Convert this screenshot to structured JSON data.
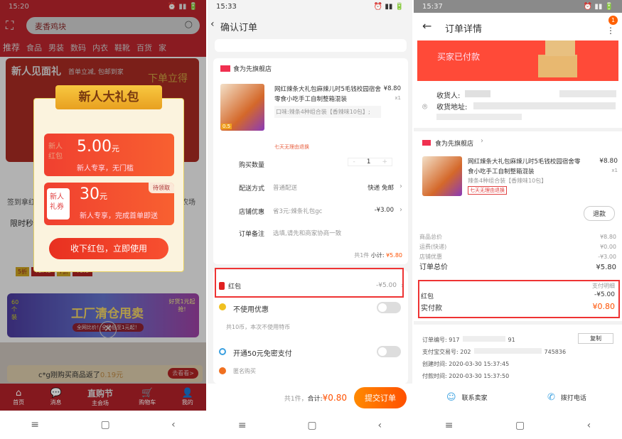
{
  "p1": {
    "time": "15:20",
    "search_value": "麦香鸡块",
    "tabs": [
      "推荐",
      "食品",
      "男装",
      "数码",
      "内衣",
      "鞋靴",
      "百货",
      "家"
    ],
    "banner_title": "新人见面礼",
    "banner_sub": "首单立减, 包邮到家",
    "banner_right": "下单立得",
    "side_left": "签到拿红",
    "side_right": "农场",
    "flash": "限时秒",
    "modal": {
      "title": "新人大礼包",
      "coupon1": {
        "tag": "新人红包",
        "amount": "5.00",
        "unit": "元",
        "desc": "新人专享，无门槛"
      },
      "coupon2": {
        "tag": "新人礼券",
        "amount": "30",
        "unit": "元",
        "desc": "新人专享，完成首单即送",
        "badge": "待领取"
      },
      "button": "收下红包，立即使用"
    },
    "discount_tags": [
      "5折",
      "¥2.45",
      "7折",
      "¥9.8"
    ],
    "promo_title": "工厂清仓甩卖",
    "promo_sub": "全网比价！全场低至1元起！",
    "promo_left": "60个装",
    "promo_right": "好货1元起 抢!",
    "ticker": "c*g刚购买商品返了",
    "ticker_amount": "0.19元",
    "ticker_btn": "去看看>",
    "nav": [
      "首页",
      "消息",
      "直购节",
      "购物车",
      "我的"
    ],
    "nav_sub": "主会场"
  },
  "p2": {
    "time": "15:33",
    "title": "确认订单",
    "store": "食为先旗舰店",
    "product": {
      "name": "网红辣条大礼包麻辣儿时5毛钱校园宿舍零食小吃手工自制整箱混装",
      "price": "¥8.80",
      "qty": "x1",
      "sku": "口味:辣条4种组合装【香辣味10包】;",
      "tag": "七天无理由退换",
      "thumb_badge": "0.5"
    },
    "rows": [
      {
        "label": "购买数量",
        "value": "1"
      },
      {
        "label": "配送方式",
        "hint": "普通配送",
        "value": "快递 免邮"
      },
      {
        "label": "店铺优惠",
        "hint": "省3元:辣条礼包gc",
        "value": "-¥3.00"
      },
      {
        "label": "订单备注",
        "hint": "选填,请先和商家协商一致"
      }
    ],
    "subtotal_prefix": "共1件",
    "subtotal_label": "小计:",
    "subtotal": "¥5.80",
    "redpacket_label": "红包",
    "redpacket_value": "-¥5.00",
    "no_discount": "不使用优惠",
    "coins": "共10币，本次不使用特币",
    "free_pay": "开通50元免密支付",
    "anonymous": "匿名购买",
    "footer_count": "共1件，",
    "footer_total_label": "合计:",
    "footer_total": "¥0.80",
    "submit": "提交订单"
  },
  "p3": {
    "time": "15:37",
    "title": "订单详情",
    "badge": "1",
    "status": "买家已付款",
    "receiver_label": "收货人:",
    "address_label": "收货地址:",
    "store": "食为先旗舰店",
    "product": {
      "name": "网红辣条大礼包麻辣儿时5毛钱校园宿舍零食小吃手工自制整箱混装",
      "price": "¥8.80",
      "qty": "x1",
      "sku": "辣条4种组合装【香辣味10包】",
      "tag": "七天无理由退换"
    },
    "refund": "退款",
    "prices": [
      {
        "label": "商品总价",
        "value": "¥8.80"
      },
      {
        "label": "运费(快递)",
        "value": "¥0.00"
      },
      {
        "label": "店铺优惠",
        "value": "-¥3.00"
      }
    ],
    "total_label": "订单总价",
    "total": "¥5.80",
    "pay_detail": "支付明细",
    "redpacket_label": "红包",
    "redpacket_value": "-¥5.00",
    "paid_label": "实付款",
    "paid": "¥0.80",
    "order_no": "订单编号: 917",
    "order_no_end": "91",
    "copy": "复制",
    "alipay_no": "支付宝交易号: 202",
    "alipay_end": "745836",
    "created": "创建时间: 2020-03-30 15:37:45",
    "paid_time": "付款时间: 2020-03-30 15:37:50",
    "contact": "联系卖家",
    "call": "拨打电话"
  },
  "colors": {
    "accent": "#ff5000",
    "red": "#e02e24",
    "highlight_box": "#e33333"
  }
}
